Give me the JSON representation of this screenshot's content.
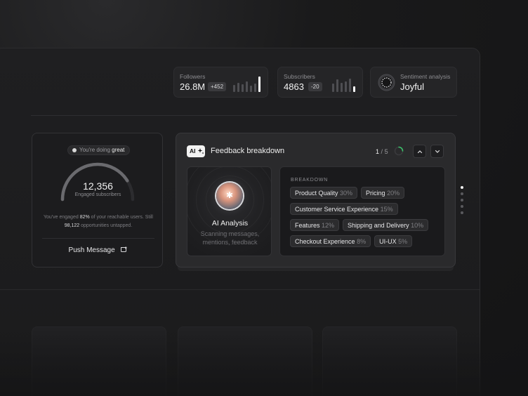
{
  "stats": {
    "followers": {
      "label": "Followers",
      "value": "26.8M",
      "delta": "+452",
      "bars": [
        0.45,
        0.6,
        0.5,
        0.7,
        0.4,
        0.55,
        1.0
      ],
      "highlight_index": 6
    },
    "subscribers": {
      "label": "Subscribers",
      "value": "4863",
      "delta": "-20",
      "bars": [
        0.55,
        0.8,
        0.6,
        0.7,
        0.85,
        0.35
      ],
      "highlight_index": 5
    },
    "sentiment": {
      "label": "Sentiment analysis",
      "value": "Joyful"
    }
  },
  "engagement": {
    "pill_prefix": "You're doing",
    "pill_emphasis": "great",
    "total": "12,356",
    "total_label": "Engaged subscribers",
    "blurb": {
      "p1": "You've engaged",
      "percent": "82%",
      "p2": "of your reachable users. Still",
      "count": "98,122",
      "p3": "opportunities untapped."
    },
    "push_label": "Push Message",
    "gauge_fraction": 0.82
  },
  "feedback": {
    "ai_chip": "AI",
    "title": "Feedback breakdown",
    "page_current": "1",
    "page_sep": "/",
    "page_total": "5",
    "ai_title": "AI Analysis",
    "ai_sub_1": "Scanning messages,",
    "ai_sub_2": "mentions, feedback",
    "breakdown_label": "BREAKDOWN",
    "tags": [
      {
        "name": "Product Quality",
        "pct": "30%"
      },
      {
        "name": "Pricing",
        "pct": "20%"
      },
      {
        "name": "Customer Service Experience",
        "pct": "15%"
      },
      {
        "name": "Features",
        "pct": "12%"
      },
      {
        "name": "Shipping and Delivery",
        "pct": "10%"
      },
      {
        "name": "Checkout Experience",
        "pct": "8%"
      },
      {
        "name": "UI-UX",
        "pct": "5%"
      }
    ]
  },
  "pagination_dots": {
    "count": 5,
    "active": 0
  },
  "icons": {
    "up": "chevron-up-icon",
    "down": "chevron-down-icon",
    "spinner": "loading-spinner-icon",
    "sentiment": "sentiment-ring-icon",
    "push": "message-icon"
  },
  "colors": {
    "accent_green": "#3bbf6a",
    "background": "#141415",
    "card": "#2a2a2c"
  }
}
